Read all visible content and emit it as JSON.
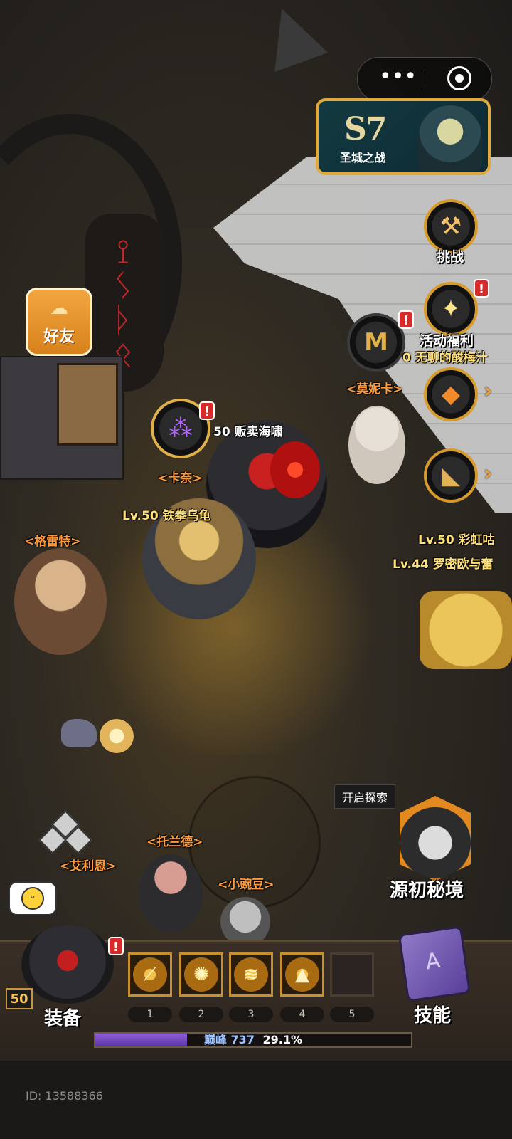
{
  "system": {
    "more_icon": "more-dots-icon",
    "close_icon": "target-close-icon"
  },
  "season": {
    "title": "S7",
    "subtitle": "圣城之战"
  },
  "side_menu": {
    "challenge": {
      "label": "挑战",
      "badge": "!",
      "icon": "hammer-icon"
    },
    "events": {
      "label": "活动福利",
      "badge": "!",
      "icon": "lantern-icon"
    },
    "monica_badge": "!",
    "gem_icon": "gem-icon",
    "dog_icon": "dog-icon"
  },
  "friend": {
    "label": "好友"
  },
  "world_labels": {
    "monica": "<莫妮卡>",
    "bored_player": "0 无聊的酸梅汁",
    "kanai": "<卡奈>",
    "seller_player": "50 贩卖海啸",
    "ironfist_player": "Lv.50 铁拳乌龟",
    "grete": "<格雷特>",
    "rainbow_player": "Lv.50 彩虹咕",
    "romeo_player": "Lv.44 罗密欧与奮",
    "tolan": "<托兰德>",
    "ailiean": "<艾利恩>",
    "pea": "<小豌豆>"
  },
  "explore": {
    "tip": "开启探索",
    "label": "源初秘境"
  },
  "bottom": {
    "level": "50",
    "equip_label": "装备",
    "skill_label": "技能",
    "slots": [
      "1",
      "2",
      "3",
      "4",
      "5"
    ],
    "peak_label": "巅峰",
    "peak_value": "737",
    "peak_percent": "29.1%",
    "peak_progress": 0.291,
    "user_id": "ID: 13588366"
  },
  "colors": {
    "accent": "#d79b2b",
    "npc_label": "#ff9a3c",
    "player_label": "#ffe07a",
    "badge": "#d62b2b",
    "xp_fill": "#7a4dc4"
  }
}
